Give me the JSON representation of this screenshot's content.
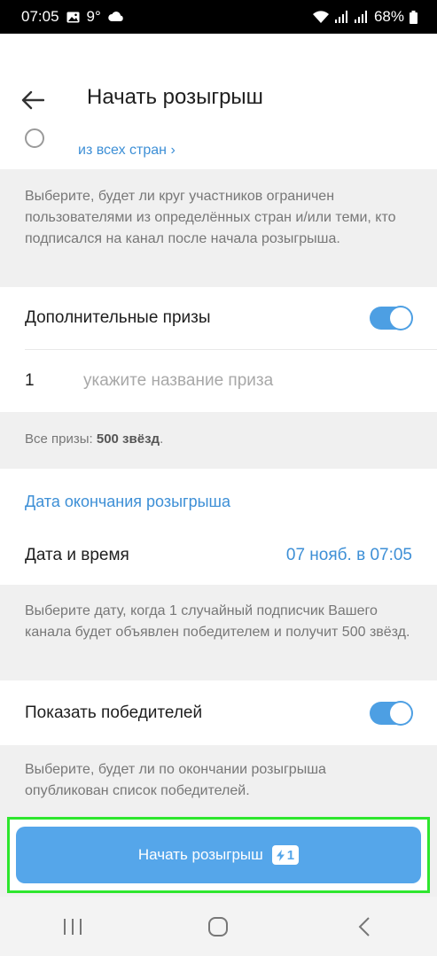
{
  "status": {
    "time": "07:05",
    "temperature": "9°",
    "battery": "68%"
  },
  "header": {
    "title": "Начать розыгрыш"
  },
  "countries": {
    "link": "из всех стран ›"
  },
  "participants_info": "Выберите, будет ли круг участников ограничен пользователями из определённых стран и/или теми, кто подписался на канал после начала розыгрыша.",
  "additional_prizes": {
    "label": "Дополнительные призы",
    "toggle_on": true,
    "prize_number": "1",
    "prize_placeholder": "укажите название приза",
    "total_label": "Все призы: ",
    "total_value": "500 звёзд",
    "total_suffix": "."
  },
  "end_date": {
    "section_title": "Дата окончания розыгрыша",
    "label": "Дата и время",
    "value": "07 нояб. в 07:05",
    "info": "Выберите дату, когда 1 случайный подписчик Вашего канала будет объявлен победителем и получит 500 звёзд."
  },
  "show_winners": {
    "label": "Показать победителей",
    "toggle_on": true,
    "info": "Выберите, будет ли по окончании розыгрыша опубликован список победителей."
  },
  "start_button": {
    "label": "Начать розыгрыш",
    "badge": "1"
  },
  "colors": {
    "accent": "#3d8fd6",
    "button": "#55a6ea",
    "highlight": "#2ee62e"
  }
}
